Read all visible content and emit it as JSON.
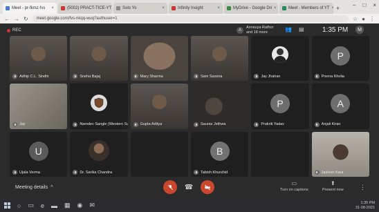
{
  "browser": {
    "tabs": [
      {
        "label": "Meet - pr-fkmz-fvs",
        "active": true
      },
      {
        "label": "(5002) PRACT-TICE-YT"
      },
      {
        "label": "Solo Yo"
      },
      {
        "label": "Infinity Insight"
      },
      {
        "label": "MyDrive - Google Dri"
      },
      {
        "label": "Meet - Members of YT"
      }
    ],
    "new_tab": "+",
    "url": "meet.google.com/fvs-nkqq-wuq?authuser=1"
  },
  "meeting": {
    "recording_label": "REC",
    "presenter": {
      "initial": "A",
      "name": "Annsuya Rathor and 18 more"
    },
    "clock": "1:35 PM",
    "user_initial": "M",
    "participants": [
      {
        "name": "Adhip C.L. Sindhi",
        "type": "video",
        "scene": "person"
      },
      {
        "name": "Sneha Bajaj",
        "type": "video",
        "scene": "person"
      },
      {
        "name": "Mary Sharma",
        "type": "video",
        "scene": "face"
      },
      {
        "name": "Sam Saxena",
        "type": "video",
        "scene": "person"
      },
      {
        "name": "Jay Jhahan",
        "type": "video",
        "scene": "avatar-photo"
      },
      {
        "name": "Prerna Kholia",
        "type": "letter",
        "initial": "P",
        "color": "#6e6e6e"
      },
      {
        "name": "Jay",
        "type": "video",
        "scene": "bright"
      },
      {
        "name": "Namdev Sangle (Western Sub..)",
        "type": "badge"
      },
      {
        "name": "Gupta Aditya",
        "type": "video",
        "scene": "person"
      },
      {
        "name": "Saurav Jethwa",
        "type": "video",
        "scene": "dark"
      },
      {
        "name": "Prakriti Yadav",
        "type": "letter",
        "initial": "P",
        "color": "#6e6e6e"
      },
      {
        "name": "Anjali Kiran",
        "type": "letter",
        "initial": "A",
        "color": "#6e6e6e"
      },
      {
        "name": "Ujala Verma",
        "type": "letter",
        "initial": "U",
        "color": "#5b5b5b"
      },
      {
        "name": "Dr. Sarika Chandra",
        "type": "avatar-round"
      },
      {
        "name": "",
        "type": "empty"
      },
      {
        "name": "Tabish Khurshid",
        "type": "letter",
        "initial": "B",
        "color": "#727272"
      },
      {
        "name": "",
        "type": "empty"
      },
      {
        "name": "Jasleen Kaur",
        "type": "video",
        "scene": "person-bright"
      }
    ],
    "details_label": "Meeting details",
    "details_chevron": "^",
    "controls": {
      "mic_icon": "mic-off-icon",
      "end_icon": "phone-icon",
      "cam_icon": "camera-off-icon",
      "captions_label": "Turn on captions",
      "present_label": "Present now"
    },
    "accent": "#c9472f"
  },
  "taskbar": {
    "clock": "1:35 PM",
    "date": "31-08-2021"
  }
}
